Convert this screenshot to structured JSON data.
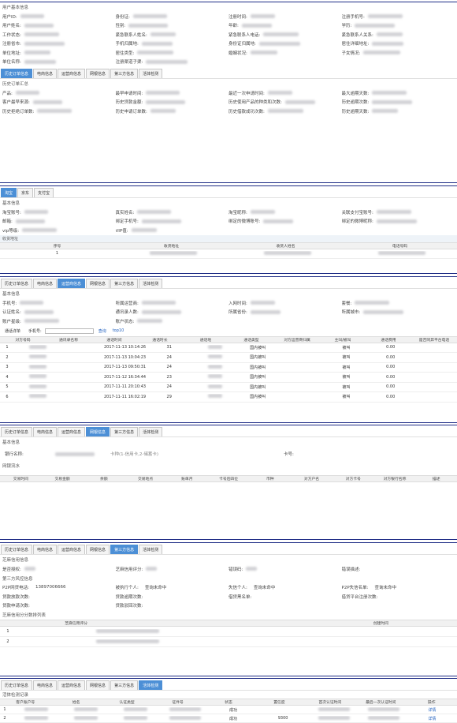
{
  "p1": {
    "title": "用户基本信息",
    "fields": [
      [
        "用户ID:",
        "身份证:",
        "注册时间:",
        "注册手机号:"
      ],
      [
        "用户姓名:",
        "性别:",
        "年龄:",
        "学历:"
      ],
      [
        "工作状态:",
        "紧急联系人姓名:",
        "紧急联系人电话:",
        "紧急联系人关系:"
      ],
      [
        "注册省市:",
        "手机归属地:",
        "身份证归属地:",
        "居住详细地址:"
      ],
      [
        "单位地址:",
        "居住类型:",
        "婚姻状况:",
        "子女情况:"
      ],
      [
        "单位名称:",
        "注册渠道子渠:",
        "",
        ""
      ]
    ],
    "tabs": [
      "历史订单信息",
      "电商信息",
      "运营商信息",
      "网银信息",
      "第三方信息",
      "活体检测"
    ],
    "active_tab": 0,
    "section": "历史订单汇总",
    "summary": [
      [
        "产品:",
        "最早申请时间:",
        "最近一次申请时间:",
        "最大逾期天数:"
      ],
      [
        "客户最早来源:",
        "历史贷款金额:",
        "历史使用产品的种类和次数:",
        "历史逾期次数:"
      ],
      [
        "历史拒绝订单数:",
        "历史申请订单数:",
        "历史借款成功次数:",
        "历史逾期天数:"
      ]
    ]
  },
  "p2": {
    "tabs": [
      "淘宝",
      "京东",
      "支付宝"
    ],
    "active_tab": 0,
    "section": "基本信息",
    "fields": [
      [
        "淘宝账号:",
        "真实姓名:",
        "淘宝昵称:",
        "关联支付宝账号:"
      ],
      [
        "邮箱:",
        "绑定手机号:",
        "绑定的微博账号:",
        "绑定的微博昵称:"
      ],
      [
        "vip等级:",
        "VIP值:",
        "",
        ""
      ]
    ],
    "addr_title": "收货地址",
    "cols": [
      "序号",
      "收货地址",
      "收货人姓名",
      "电话号码"
    ],
    "rows": [
      [
        "1",
        "",
        "",
        ""
      ]
    ]
  },
  "p3": {
    "tabs": [
      "历史订单信息",
      "电商信息",
      "运营商信息",
      "网银信息",
      "第三方信息",
      "活体检测"
    ],
    "active_tab": 2,
    "section": "基本信息",
    "fields": [
      [
        "手机号:",
        "所属运营商:",
        "入网时间:",
        "套餐:"
      ],
      [
        "认证姓名:",
        "通讯录人数:",
        "所属省份:",
        "所属城市:"
      ],
      [
        "账户星级:",
        "账户状态:",
        "",
        ""
      ]
    ],
    "search_label": "通话详单",
    "search_field_label": "手机号:",
    "search_btn": "查询",
    "top_btn": "top10",
    "cols": [
      "对方号码",
      "通讯录名称",
      "通话时间",
      "通话时长",
      "通话地",
      "通话类型",
      "对方运营商归属",
      "主叫/被叫",
      "通话费用",
      "是否同异平台电话"
    ],
    "rows": [
      {
        "n": "1",
        "time": "2017-11-13 10:14:26",
        "dur": "31",
        "type": "国内被叫",
        "dir": "被叫",
        "fee": "0.00"
      },
      {
        "n": "2",
        "time": "2017-11-13 10:04:23",
        "dur": "24",
        "type": "国内被叫",
        "dir": "被叫",
        "fee": "0.00"
      },
      {
        "n": "3",
        "time": "2017-11-13 09:50:31",
        "dur": "24",
        "type": "国内被叫",
        "dir": "被叫",
        "fee": "0.00"
      },
      {
        "n": "4",
        "time": "2017-11-12 16:34:44",
        "dur": "23",
        "type": "国内被叫",
        "dir": "被叫",
        "fee": "0.00"
      },
      {
        "n": "5",
        "time": "2017-11-11 20:10:43",
        "dur": "24",
        "type": "国内被叫",
        "dir": "被叫",
        "fee": "0.00"
      },
      {
        "n": "6",
        "time": "2017-11-11 16:02:19",
        "dur": "29",
        "type": "国内被叫",
        "dir": "被叫",
        "fee": "0.00"
      }
    ]
  },
  "p4": {
    "tabs": [
      "历史订单信息",
      "电商信息",
      "运营商信息",
      "网银信息",
      "第三方信息",
      "活体检测"
    ],
    "active_tab": 3,
    "section": "基本信息",
    "bank_label": "银行名称:",
    "bank_hint": "卡种(1-信用卡,2-储蓄卡)",
    "card_label": "卡号:",
    "flow_title": "网银流水",
    "cols": [
      "交易时间",
      "交易金额",
      "余额",
      "交易地点",
      "账单月",
      "卡号后四位",
      "币种",
      "对方户名",
      "对方卡号",
      "对方银行名称",
      "描述"
    ]
  },
  "p5": {
    "tabs": [
      "历史订单信息",
      "电商信息",
      "运营商信息",
      "网银信息",
      "第三方信息",
      "活体检测"
    ],
    "active_tab": 4,
    "zhima_title": "芝麻信用信息",
    "zhima_fields": [
      "是否授权:",
      "芝麻信用评分:",
      "错误码:",
      "错误描述:"
    ],
    "third_title": "第三方风控信息",
    "third_rows": [
      [
        "P2P网贷电话:",
        "13897006666",
        "被执行个人:",
        "查询未命中",
        "失信个人:",
        "查询未命中",
        "P2P失信名单:",
        "查询未命中"
      ],
      [
        "贷款放款次数:",
        "",
        "贷款逾期次数:",
        "",
        "借贷黑名单:",
        "",
        "借贷平台注册次数:",
        ""
      ],
      [
        "贷款申请次数:",
        "",
        "贷款驳回次数:",
        "",
        "",
        "",
        "",
        ""
      ]
    ],
    "score_title": "芝麻信用分分数排列表",
    "score_cols": [
      "芝麻信用评分",
      "",
      "创建时间"
    ],
    "score_rows": [
      [
        "1",
        "",
        ""
      ],
      [
        "2",
        "",
        ""
      ]
    ]
  },
  "p6": {
    "tabs": [
      "历史订单信息",
      "电商信息",
      "运营商信息",
      "网银信息",
      "第三方信息",
      "活体检测"
    ],
    "active_tab": 5,
    "section": "活体检测记录",
    "cols": [
      "客户账户号",
      "姓名",
      "认证类型",
      "证件号",
      "状态",
      "置信度",
      "首次认证时间",
      "最后一次认证时间",
      "操作"
    ],
    "rows": [
      {
        "n": "1",
        "status": "成功",
        "score": "",
        "op": "详情"
      },
      {
        "n": "2",
        "status": "成功",
        "score": "9300",
        "op": "详情"
      }
    ]
  },
  "colors": {
    "border": "#1f2d86",
    "tab_active": "#4c8fd6"
  }
}
